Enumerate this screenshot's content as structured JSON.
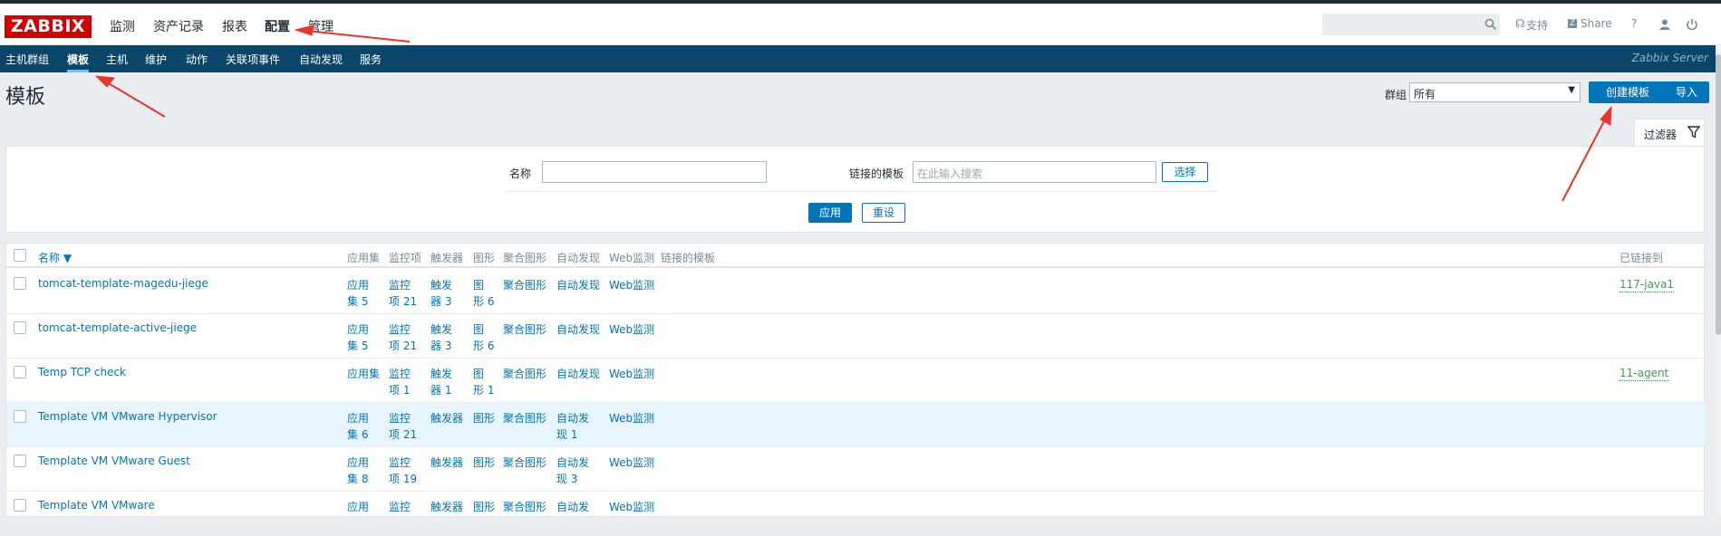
{
  "logo": "ZABBIX",
  "main_nav": [
    "监测",
    "资产记录",
    "报表",
    "配置",
    "管理"
  ],
  "top_links": {
    "support": "支持",
    "share": "Share",
    "help": "?"
  },
  "sub_nav": [
    "主机群组",
    "模板",
    "主机",
    "维护",
    "动作",
    "关联项事件",
    "自动发现",
    "服务"
  ],
  "server_name": "Zabbix Server",
  "page_title": "模板",
  "group_filter": {
    "label": "群组",
    "value": "所有"
  },
  "buttons": {
    "create": "创建模板",
    "import": "导入",
    "select": "选择",
    "apply": "应用",
    "reset": "重设"
  },
  "filter": {
    "tab_label": "过滤器",
    "name_label": "名称",
    "name_value": "",
    "linked_label": "链接的模板",
    "linked_placeholder": "在此输入搜索"
  },
  "table": {
    "headers": {
      "name": "名称 ▼",
      "apps": "应用集",
      "items": "监控项",
      "triggers": "触发器",
      "graphs": "图形",
      "screens": "聚合图形",
      "discovery": "自动发现",
      "web": "Web监测",
      "linked_templates": "链接的模板",
      "linked_to": "已链接到"
    },
    "rows": [
      {
        "name": "tomcat-template-magedu-jiege",
        "apps": "应用\n集 5",
        "items": "监控\n项 21",
        "triggers": "触发\n器 3",
        "graphs": "图\n形 6",
        "screens": "聚合图形",
        "discovery": "自动发现",
        "web": "Web监测",
        "linked_to": "117-java1"
      },
      {
        "name": "tomcat-template-active-jiege",
        "apps": "应用\n集 5",
        "items": "监控\n项 21",
        "triggers": "触发\n器 3",
        "graphs": "图\n形 6",
        "screens": "聚合图形",
        "discovery": "自动发现",
        "web": "Web监测",
        "linked_to": ""
      },
      {
        "name": "Temp TCP check",
        "apps": "应用集",
        "items": "监控\n项 1",
        "triggers": "触发\n器 1",
        "graphs": "图\n形 1",
        "screens": "聚合图形",
        "discovery": "自动发现",
        "web": "Web监测",
        "linked_to": "11-agent"
      },
      {
        "name": "Template VM VMware Hypervisor",
        "apps": "应用\n集 6",
        "items": "监控\n项 21",
        "triggers": "触发器",
        "graphs": "图形",
        "screens": "聚合图形",
        "discovery": "自动发\n现 1",
        "web": "Web监测",
        "linked_to": ""
      },
      {
        "name": "Template VM VMware Guest",
        "apps": "应用\n集 8",
        "items": "监控\n项 19",
        "triggers": "触发器",
        "graphs": "图形",
        "screens": "聚合图形",
        "discovery": "自动发\n现 3",
        "web": "Web监测",
        "linked_to": ""
      },
      {
        "name": "Template VM VMware",
        "apps": "应用",
        "items": "监控",
        "triggers": "触发器",
        "graphs": "图形",
        "screens": "聚合图形",
        "discovery": "自动发",
        "web": "Web监测",
        "linked_to": ""
      }
    ]
  },
  "colors": {
    "nav_bg": "#0a466a",
    "link": "#0275b8",
    "logo_red": "#d40000",
    "annotation_red": "#e8362c",
    "linked_green": "#429e47"
  }
}
